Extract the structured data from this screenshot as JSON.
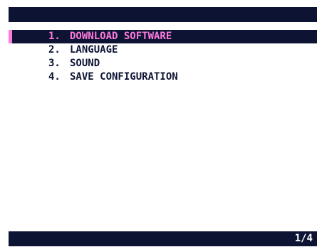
{
  "colors": {
    "background": "#ffffff",
    "bar": "#0d1433",
    "text": "#0d1433",
    "highlight_text": "#ff7bdb",
    "status_text": "#ffffff"
  },
  "menu": {
    "selected_index": 0,
    "items": [
      {
        "number": "1.",
        "label": "DOWNLOAD SOFTWARE"
      },
      {
        "number": "2.",
        "label": "LANGUAGE"
      },
      {
        "number": "3.",
        "label": "SOUND"
      },
      {
        "number": "4.",
        "label": "SAVE CONFIGURATION"
      }
    ]
  },
  "status_bar": {
    "page_indicator": "1/4"
  }
}
